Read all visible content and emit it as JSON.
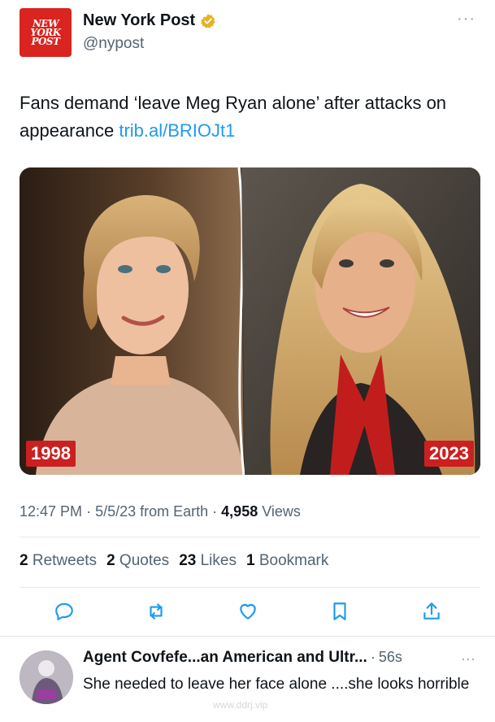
{
  "author": {
    "logo_lines": [
      "NEW",
      "YORK",
      "POST"
    ],
    "display_name": "New York Post",
    "handle": "@nypost",
    "verified_icon": "verified-badge-gold",
    "more_icon": "more-dots-icon"
  },
  "tweet": {
    "text": "Fans demand ‘leave Meg Ryan alone’ after attacks on appearance ",
    "link": "trib.al/BRIOJt1"
  },
  "media": {
    "left_year": "1998",
    "right_year": "2023",
    "tag_color": "#cc1f1f"
  },
  "meta": {
    "time": "12:47 PM",
    "date": "5/5/23",
    "source": "from Earth",
    "views_count": "4,958",
    "views_label": "Views"
  },
  "stats": [
    {
      "count": "2",
      "label": "Retweets"
    },
    {
      "count": "2",
      "label": "Quotes"
    },
    {
      "count": "23",
      "label": "Likes"
    },
    {
      "count": "1",
      "label": "Bookmark"
    }
  ],
  "actions": [
    "reply-icon",
    "retweet-icon",
    "like-icon",
    "bookmark-icon",
    "share-icon"
  ],
  "reply": {
    "name": "Agent Covfefe...an American and Ultr...",
    "time": "56s",
    "text": "She needed to leave her face alone ....she looks horrible",
    "watermark": "www.ddrj.vip"
  },
  "colors": {
    "link": "#1d9bf0",
    "secondary_text": "#536471",
    "brand_red": "#d9241f"
  }
}
